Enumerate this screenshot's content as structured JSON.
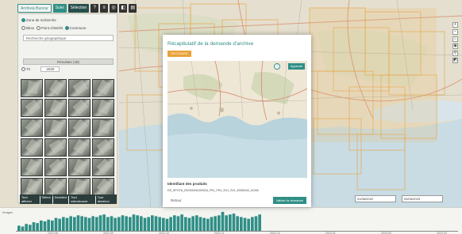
{
  "toolbar": {
    "buttons": [
      "Archivia Buscar",
      "Suivi",
      "Sélection"
    ],
    "icons": [
      "?",
      "≡",
      "◎",
      "◧",
      "▤"
    ]
  },
  "panel": {
    "zone_label": "Zone de recherche",
    "radio_options": [
      "Bbox",
      "Point d'intérêt",
      "Commune"
    ],
    "radio_selected_index": 2,
    "option_line": "Recherche géographique",
    "results_label": "Résultats (48)",
    "sort_label": "Tri",
    "select_value": "2020",
    "footer_buttons": [
      "Tout afficher",
      "Sélect",
      "Désélect",
      "Tout sélectionner",
      "Tout désélect"
    ]
  },
  "map_controls": [
    "+",
    "−",
    "⌂",
    "◉",
    "⚲",
    "◩"
  ],
  "dates": {
    "start": "01/08/2022",
    "end": "09/05/2023"
  },
  "histogram": {
    "label": "Images",
    "bars": [
      6,
      5,
      8,
      7,
      10,
      9,
      12,
      11,
      13,
      12,
      15,
      14,
      16,
      15,
      17,
      16,
      18,
      17,
      16,
      15,
      17,
      16,
      18,
      19,
      16,
      17,
      15,
      16,
      18,
      17,
      16,
      19,
      18,
      17,
      15,
      16,
      18,
      17,
      16,
      15,
      14,
      16,
      18,
      17,
      19,
      16,
      15,
      17,
      18,
      16,
      15,
      14,
      16,
      17,
      18,
      22,
      18,
      19,
      20,
      17,
      16,
      15,
      14,
      16,
      17,
      19
    ],
    "ticks": [
      "2022-08",
      "2022-09",
      "2022-10",
      "2022-11",
      "2022-12",
      "2023-01",
      "2023-02",
      "2023-03"
    ],
    "color": "#2f8f86"
  },
  "modal": {
    "title": "Récapitulatif de la demande d'archive",
    "badge": "EN COURS",
    "map_button": "Agrandir",
    "ident_label": "Identifiant des produits",
    "ident_value": "DS_SPOT6_202302041009318_FR1_FR1_SV1_SV1_E005N43_01340",
    "back_label": "Retour",
    "confirm_label": "Valider la demande",
    "accent": "#2f8f86"
  }
}
